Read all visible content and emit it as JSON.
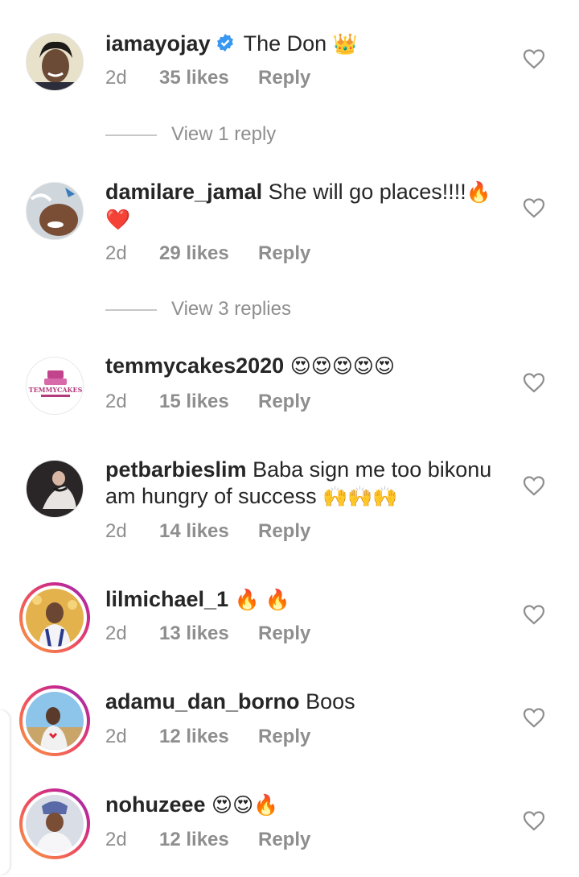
{
  "comments": [
    {
      "username": "iamayojay",
      "verified": true,
      "text": "The Don",
      "emoji": "👑",
      "time": "2d",
      "likes": "35 likes",
      "reply": "Reply",
      "view_replies": "View 1 reply"
    },
    {
      "username": "damilare_jamal",
      "text": "She will go places!!!!",
      "emoji": "🔥❤️",
      "time": "2d",
      "likes": "29 likes",
      "reply": "Reply",
      "view_replies": "View 3 replies"
    },
    {
      "username": "temmycakes2020",
      "text": "",
      "emoji": "😍😍😍😍😍",
      "time": "2d",
      "likes": "15 likes",
      "reply": "Reply",
      "avatar_text": "TEMMYCAKES"
    },
    {
      "username": "petbarbieslim",
      "text": "Baba sign me too bikonu am hungry of success",
      "emoji": "🙌🙌🙌",
      "time": "2d",
      "likes": "14 likes",
      "reply": "Reply"
    },
    {
      "username": "lilmichael_1",
      "text": "",
      "emoji": "🔥 🔥",
      "time": "2d",
      "likes": "13 likes",
      "reply": "Reply"
    },
    {
      "username": "adamu_dan_borno",
      "text": "Boos",
      "emoji": "",
      "time": "2d",
      "likes": "12 likes",
      "reply": "Reply"
    },
    {
      "username": "nohuzeee",
      "text": "",
      "emoji": "😍😍🔥",
      "time": "2d",
      "likes": "12 likes",
      "reply": "Reply"
    }
  ],
  "colors": {
    "text": "#262626",
    "secondary": "#8e8e8e",
    "verified": "#3897f0",
    "story_ring": [
      "#f9a03f",
      "#ef4f5f",
      "#c8288e",
      "#8a3ab9"
    ]
  }
}
